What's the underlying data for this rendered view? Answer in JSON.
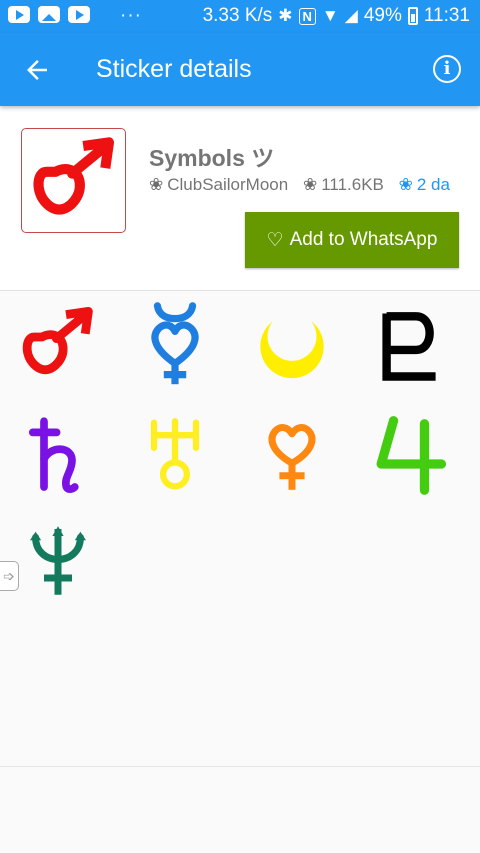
{
  "status_bar": {
    "dots": "···",
    "speed": "3.33 K/s",
    "bluetooth_icon": "bluetooth-icon",
    "nfc_icon": "nfc-icon",
    "battery": "49%",
    "time": "11:31"
  },
  "app_bar": {
    "title": "Sticker details",
    "back_icon": "arrow-left-icon",
    "info_icon": "info-icon"
  },
  "pack": {
    "name": "Symbols ツ",
    "publisher": "ClubSailorMoon",
    "size": "111.6KB",
    "extra": "2 da",
    "add_button_label": "Add to WhatsApp",
    "tray_icon": "mars-symbol-icon"
  },
  "stickers": [
    {
      "name": "mars-symbol-icon",
      "color": "#ee1111"
    },
    {
      "name": "mercury-symbol-icon",
      "color": "#1f7fe0"
    },
    {
      "name": "crescent-moon-icon",
      "color": "#ffee00"
    },
    {
      "name": "pluto-symbol-icon",
      "color": "#000000"
    },
    {
      "name": "saturn-symbol-icon",
      "color": "#7a12e6"
    },
    {
      "name": "uranus-symbol-icon",
      "color": "#ffee22"
    },
    {
      "name": "venus-symbol-icon",
      "color": "#ff8811"
    },
    {
      "name": "jupiter-symbol-icon",
      "color": "#44cc11"
    },
    {
      "name": "neptune-symbol-icon",
      "color": "#137a5e"
    }
  ],
  "colors": {
    "primary": "#2196f3",
    "add_button": "#669900"
  }
}
